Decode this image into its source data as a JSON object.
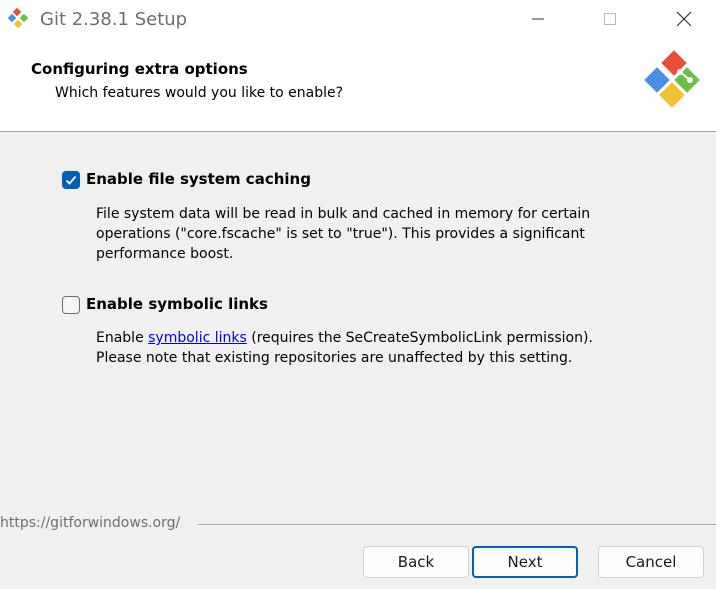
{
  "window": {
    "title": "Git 2.38.1 Setup",
    "controls": [
      "minimize-icon",
      "maximize-icon",
      "close-icon"
    ]
  },
  "header": {
    "title": "Configuring extra options",
    "subtitle": "Which features would you like to enable?",
    "logo": "git-logo-icon"
  },
  "options": [
    {
      "label": "Enable file system caching",
      "checked": true,
      "description_lines": [
        "File system data will be read in bulk and cached in memory for certain",
        "operations (\"core.fscache\" is set to \"true\"). This provides a significant",
        "performance boost."
      ]
    },
    {
      "label": "Enable symbolic links",
      "checked": false,
      "description_prefix": "Enable ",
      "description_link": "symbolic links",
      "description_suffix": " (requires the SeCreateSymbolicLink permission).",
      "description_line2": "Please note that existing repositories are unaffected by this setting."
    }
  ],
  "footer": {
    "url": "https://gitforwindows.org/"
  },
  "buttons": {
    "back": "Back",
    "next": "Next",
    "cancel": "Cancel"
  },
  "colors": {
    "accent": "#005fb8",
    "link": "#0000ee"
  }
}
